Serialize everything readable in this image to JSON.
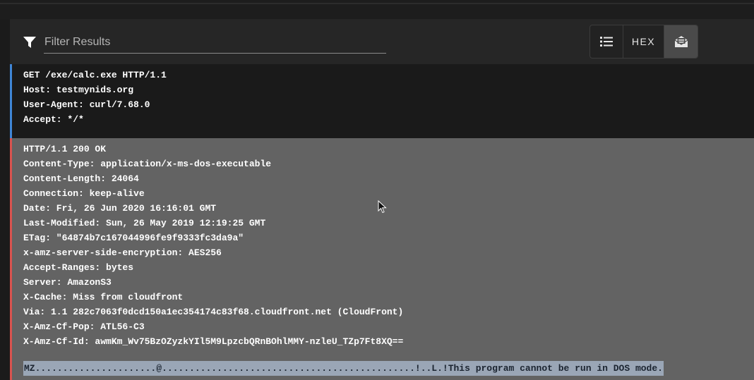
{
  "toolbar": {
    "filter_placeholder": "Filter Results",
    "buttons": {
      "list_icon": "list-icon",
      "hex_label": "HEX",
      "raw_icon": "envelope-open-icon"
    }
  },
  "request": {
    "lines": [
      "GET /exe/calc.exe HTTP/1.1",
      "Host: testmynids.org",
      "User-Agent: curl/7.68.0",
      "Accept: */*"
    ]
  },
  "response": {
    "lines": [
      "HTTP/1.1 200 OK",
      "Content-Type: application/x-ms-dos-executable",
      "Content-Length: 24064",
      "Connection: keep-alive",
      "Date: Fri, 26 Jun 2020 16:16:01 GMT",
      "Last-Modified: Sun, 26 May 2019 12:19:25 GMT",
      "ETag: \"64874b7c167044996fe9f9333fc3da9a\"",
      "x-amz-server-side-encryption: AES256",
      "Accept-Ranges: bytes",
      "Server: AmazonS3",
      "X-Cache: Miss from cloudfront",
      "Via: 1.1 282c7063f0dcd150a1ec354174c83f68.cloudfront.net (CloudFront)",
      "X-Amz-Cf-Pop: ATL56-C3",
      "X-Amz-Cf-Id: awmKm_Wv75BzOZyzkYIl5M9LpzcbQRnBOhlMMY-nzleU_TZp7Ft8XQ=="
    ],
    "payload": "MZ......................@..............................................!..L.!This program cannot be run in DOS mode."
  },
  "colors": {
    "request_accent": "#3f86d6",
    "response_accent": "#d9534f",
    "selection": "#9aa6b6"
  }
}
